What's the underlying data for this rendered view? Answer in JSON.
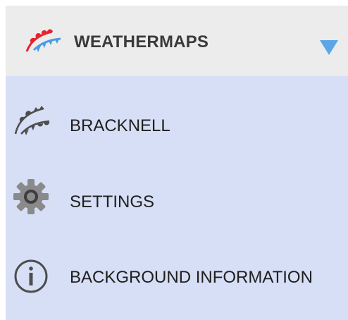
{
  "header": {
    "title": "WEATHERMAPS",
    "logo_icon": "weather-front-icon",
    "dropdown_icon": "triangle-down-icon",
    "accent_colors": {
      "warm_front": "#e4232b",
      "cold_front": "#4a9be0",
      "dropdown": "#5aa6e6"
    }
  },
  "menu": {
    "items": [
      {
        "label": "BRACKNELL",
        "icon": "bracknell-front-icon"
      },
      {
        "label": "SETTINGS",
        "icon": "gear-icon"
      },
      {
        "label": "BACKGROUND INFORMATION",
        "icon": "info-icon"
      }
    ]
  },
  "colors": {
    "menu_background": "#d6dff5",
    "header_background": "#ececec"
  }
}
